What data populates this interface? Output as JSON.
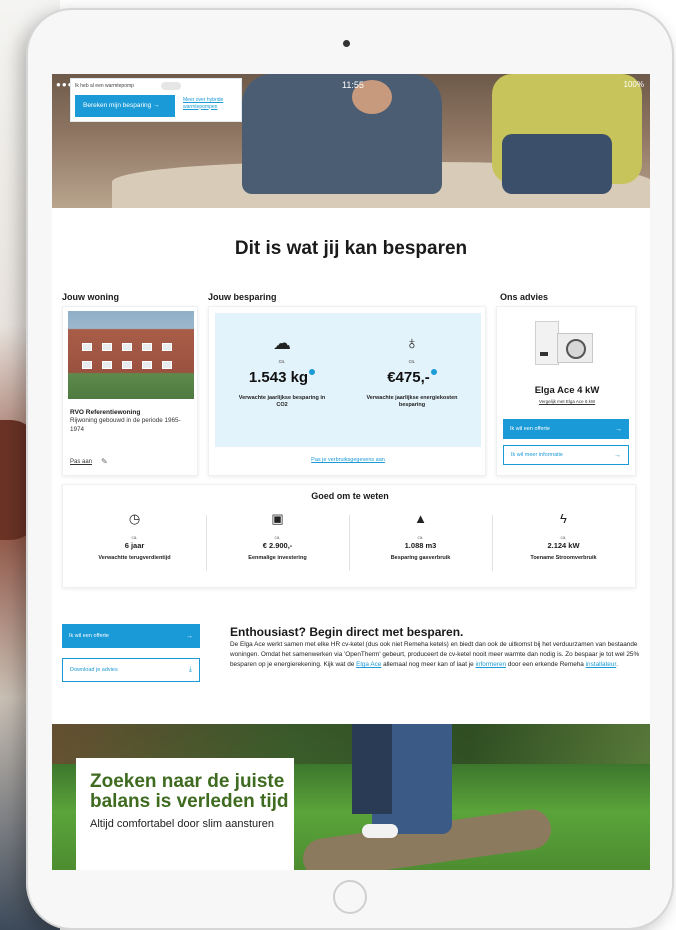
{
  "hero": {
    "status_time": "11:55",
    "status_right": "100%",
    "calc_tiny": "Ik heb al een warmtepomp",
    "calc_button": "Bereken mijn besparing",
    "calc_link": "Meer over hybride warmtepompen"
  },
  "main_title": "Dit is wat jij kan besparen",
  "woning": {
    "heading": "Jouw woning",
    "name": "RVO Referentiewoning",
    "description": "Rijwoning gebouwd in de periode 1965-1974",
    "edit_link": "Pas aan"
  },
  "besparing": {
    "heading": "Jouw besparing",
    "co2": {
      "ca": "ca.",
      "value": "1.543 kg",
      "label": "Verwachte jaarlijkse besparing in CO2",
      "icon": "co2-cloud-icon"
    },
    "kosten": {
      "ca": "ca.",
      "value": "€475,-",
      "label": "Verwachte jaarlijkse energiekosten besparing",
      "icon": "piggy-bank-icon"
    },
    "link": "Pas je verbruiksgegevens aan"
  },
  "advies": {
    "heading": "Ons advies",
    "product": "Elga Ace 4 kW",
    "compare_link": "Vergelijk met Elga Ace 6 kW",
    "btn_offerte": "Ik wil een offerte",
    "btn_info": "Ik wil meer informatie"
  },
  "weten": {
    "title": "Goed om te weten",
    "items": [
      {
        "icon": "clock-icon",
        "ca": "ca.",
        "value": "6 jaar",
        "label": "Verwachtte terugverdientijd"
      },
      {
        "icon": "wallet-icon",
        "ca": "ca.",
        "value": "€ 2.900,-",
        "label": "Eenmalige investering"
      },
      {
        "icon": "flame-icon",
        "ca": "ca.",
        "value": "1.088 m3",
        "label": "Besparing gasverbruik"
      },
      {
        "icon": "lightning-icon",
        "ca": "ca.",
        "value": "2.124 kW",
        "label": "Toename Stroomverbruik"
      }
    ]
  },
  "enthousiast": {
    "btn_offerte": "Ik wil een offerte",
    "btn_download": "Download je advies",
    "title": "Enthousiast? Begin direct met besparen.",
    "text_1": "De  Elga Ace werkt samen met elke HR cv-ketel (dus ook niet Remeha ketels) en biedt dan ook de uitkomst bij het verduurzamen van bestaande woningen. Omdat het samenwerken via 'OpenTherm' gebeurt, produceert de cv-ketel nooit meer warmte dan nodig is.  Zo bespaar je tot wel 25% besparen op je energierekening. Kijk wat de ",
    "link_1": "Elga Ace",
    "text_2": " allemaal nog meer kan of laat je ",
    "link_2": "informeren",
    "text_3": " door een erkende Remeha ",
    "link_3": "installateur",
    "text_4": "."
  },
  "banner": {
    "title": "Zoeken naar de juiste balans is verleden tijd",
    "subtitle": "Altijd comfortabel door slim aansturen"
  },
  "colors": {
    "accent": "#1a9ad6",
    "besparing_bg": "#e3f3fb",
    "banner_title": "#3e6b1f"
  }
}
